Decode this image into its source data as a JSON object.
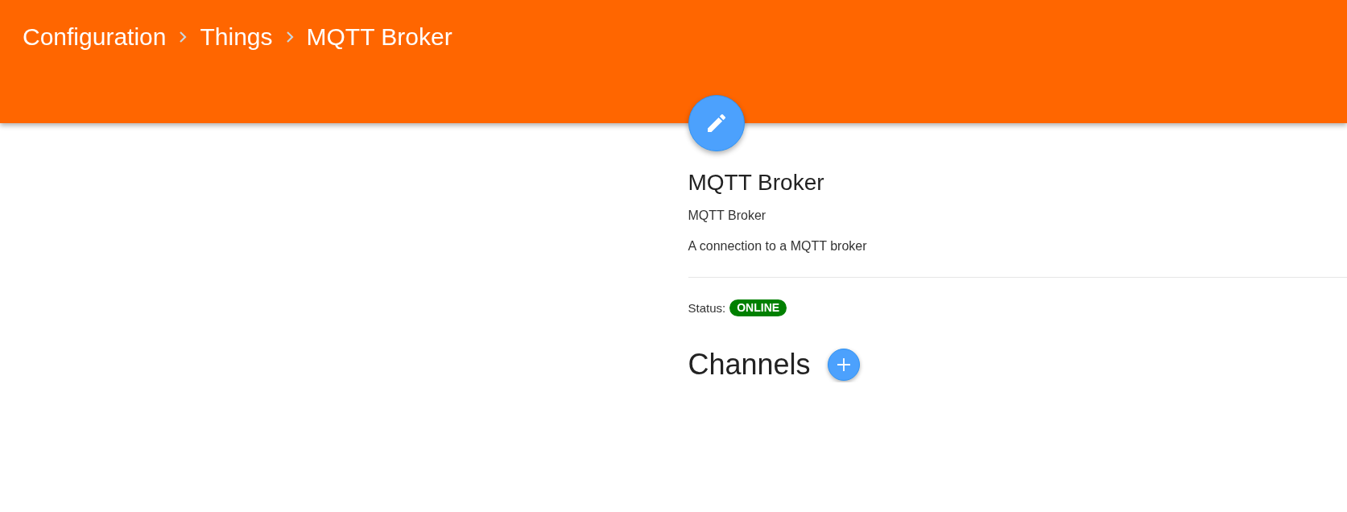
{
  "header": {
    "breadcrumb": [
      {
        "label": "Configuration"
      },
      {
        "label": "Things"
      },
      {
        "label": "MQTT Broker"
      }
    ]
  },
  "thing": {
    "title": "MQTT Broker",
    "type": "MQTT Broker",
    "description": "A connection to a MQTT broker",
    "status_label": "Status:",
    "status": "ONLINE"
  },
  "channels": {
    "heading": "Channels"
  }
}
